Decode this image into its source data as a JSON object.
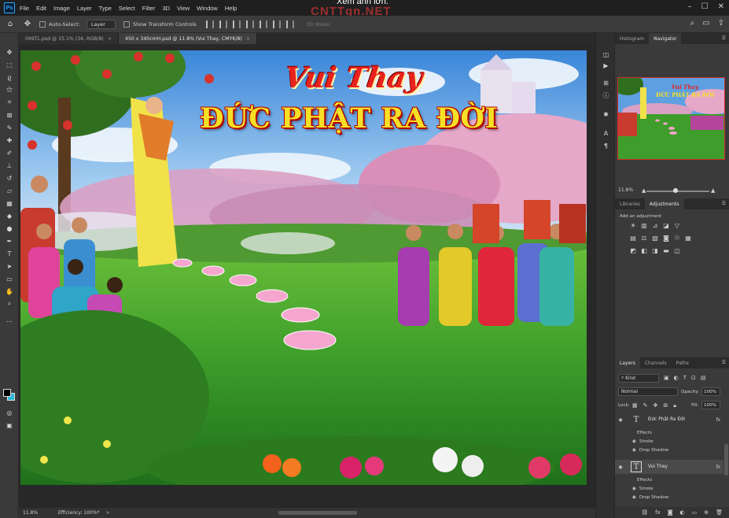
{
  "app": {
    "logo": "Ps"
  },
  "menu": [
    "File",
    "Edit",
    "Image",
    "Layer",
    "Type",
    "Select",
    "Filter",
    "3D",
    "View",
    "Window",
    "Help"
  ],
  "overlay": {
    "watermark": "CNTTqn.NET",
    "tooltip": "Xem ảnh lớn."
  },
  "options_bar": {
    "auto_select_label": "Auto-Select:",
    "auto_select_value": "Layer",
    "transform_label": "Show Transform Controls",
    "mode_3d_label": "3D Mode:"
  },
  "tabs": [
    {
      "label": "099TL.psd @ 15.1% (34, RGB/8)"
    },
    {
      "label": "450 x 340cmH.psd @ 11.8% (Vui Thay, CMYK/8)"
    }
  ],
  "artwork": {
    "title_script": "Vui Thay",
    "title_main": "ĐỨC PHẬT RA ĐỜI"
  },
  "status": {
    "zoom": "11.8%",
    "efficiency": "Efficiency: 100%*",
    "arrow": ">"
  },
  "navigator_panel": {
    "tabs": [
      "Histogram",
      "Navigator"
    ],
    "active_tab": "Navigator",
    "zoom": "11.8%"
  },
  "adjustments_panel": {
    "tabs": [
      "Libraries",
      "Adjustments"
    ],
    "active_tab": "Adjustments",
    "hint": "Add an adjustment"
  },
  "layers_panel": {
    "tabs": [
      "Layers",
      "Channels",
      "Paths"
    ],
    "active_tab": "Layers",
    "filter_kind": "Kind",
    "blend_mode": "Normal",
    "opacity_label": "Opacity:",
    "opacity_value": "100%",
    "lock_label": "Lock:",
    "fill_label": "Fill:",
    "fill_value": "100%",
    "layers": [
      {
        "name": "Đức Phật Ra Đời",
        "type": "text",
        "fx": "fx",
        "effects": [
          "Effects",
          "Stroke",
          "Drop Shadow"
        ],
        "selected": false
      },
      {
        "name": "Vui Thay",
        "type": "text",
        "fx": "fx",
        "effects": [
          "Effects",
          "Stroke",
          "Drop Shadow"
        ],
        "selected": true
      }
    ]
  },
  "colors": {
    "foreground": "#000000",
    "background": "#2fb7d8",
    "accent": "#31a8ff"
  }
}
